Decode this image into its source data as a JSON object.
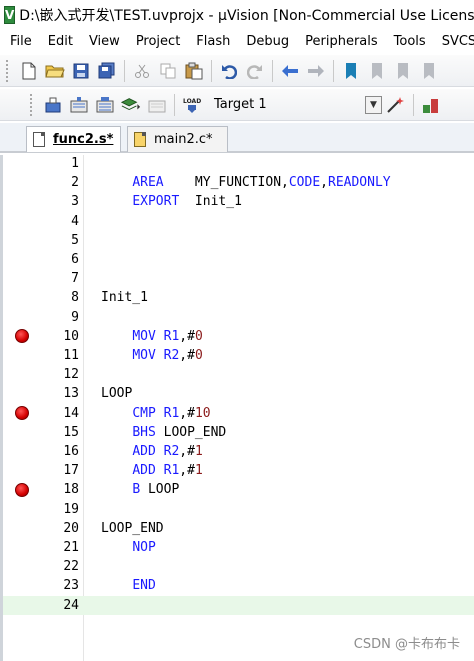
{
  "window": {
    "title": "D:\\嵌入式开发\\TEST.uvprojx - µVision  [Non-Commercial Use License]",
    "icon": "V"
  },
  "menu": [
    "File",
    "Edit",
    "View",
    "Project",
    "Flash",
    "Debug",
    "Peripherals",
    "Tools",
    "SVCS"
  ],
  "build_toolbar": {
    "target": "Target 1"
  },
  "tabs": [
    {
      "label": "func2.s*",
      "active": true
    },
    {
      "label": "main2.c*",
      "active": false
    }
  ],
  "editor": {
    "current_line": 24,
    "breakpoints": [
      10,
      14,
      18
    ],
    "lines": [
      {
        "n": "1",
        "tokens": []
      },
      {
        "n": "2",
        "tokens": [
          {
            "t": "    "
          },
          {
            "t": "AREA",
            "c": "kw"
          },
          {
            "t": "    MY_FUNCTION,"
          },
          {
            "t": "CODE",
            "c": "kw"
          },
          {
            "t": ","
          },
          {
            "t": "READONLY",
            "c": "kw"
          }
        ]
      },
      {
        "n": "3",
        "tokens": [
          {
            "t": "    "
          },
          {
            "t": "EXPORT",
            "c": "kw"
          },
          {
            "t": "  Init_1"
          }
        ]
      },
      {
        "n": "4",
        "tokens": []
      },
      {
        "n": "5",
        "tokens": []
      },
      {
        "n": "6",
        "tokens": []
      },
      {
        "n": "7",
        "tokens": []
      },
      {
        "n": "8",
        "tokens": [
          {
            "t": "Init_1"
          }
        ]
      },
      {
        "n": "9",
        "tokens": []
      },
      {
        "n": "10",
        "tokens": [
          {
            "t": "    "
          },
          {
            "t": "MOV",
            "c": "kw"
          },
          {
            "t": " "
          },
          {
            "t": "R1",
            "c": "kw"
          },
          {
            "t": ",#"
          },
          {
            "t": "0",
            "c": "num"
          }
        ]
      },
      {
        "n": "11",
        "tokens": [
          {
            "t": "    "
          },
          {
            "t": "MOV",
            "c": "kw"
          },
          {
            "t": " "
          },
          {
            "t": "R2",
            "c": "kw"
          },
          {
            "t": ",#"
          },
          {
            "t": "0",
            "c": "num"
          }
        ]
      },
      {
        "n": "12",
        "tokens": []
      },
      {
        "n": "13",
        "tokens": [
          {
            "t": "LOOP"
          }
        ]
      },
      {
        "n": "14",
        "tokens": [
          {
            "t": "    "
          },
          {
            "t": "CMP",
            "c": "kw"
          },
          {
            "t": " "
          },
          {
            "t": "R1",
            "c": "kw"
          },
          {
            "t": ",#"
          },
          {
            "t": "10",
            "c": "num"
          }
        ]
      },
      {
        "n": "15",
        "tokens": [
          {
            "t": "    "
          },
          {
            "t": "BHS",
            "c": "kw"
          },
          {
            "t": " LOOP_END"
          }
        ]
      },
      {
        "n": "16",
        "tokens": [
          {
            "t": "    "
          },
          {
            "t": "ADD",
            "c": "kw"
          },
          {
            "t": " "
          },
          {
            "t": "R2",
            "c": "kw"
          },
          {
            "t": ",#"
          },
          {
            "t": "1",
            "c": "num"
          }
        ]
      },
      {
        "n": "17",
        "tokens": [
          {
            "t": "    "
          },
          {
            "t": "ADD",
            "c": "kw"
          },
          {
            "t": " "
          },
          {
            "t": "R1",
            "c": "kw"
          },
          {
            "t": ",#"
          },
          {
            "t": "1",
            "c": "num"
          }
        ]
      },
      {
        "n": "18",
        "tokens": [
          {
            "t": "    "
          },
          {
            "t": "B",
            "c": "kw"
          },
          {
            "t": " LOOP"
          }
        ]
      },
      {
        "n": "19",
        "tokens": []
      },
      {
        "n": "20",
        "tokens": [
          {
            "t": "LOOP_END"
          }
        ]
      },
      {
        "n": "21",
        "tokens": [
          {
            "t": "    "
          },
          {
            "t": "NOP",
            "c": "kw"
          }
        ]
      },
      {
        "n": "22",
        "tokens": []
      },
      {
        "n": "23",
        "tokens": [
          {
            "t": "    "
          },
          {
            "t": "END",
            "c": "kw"
          }
        ]
      },
      {
        "n": "24",
        "tokens": []
      }
    ]
  },
  "watermark": "CSDN @卡布布卡",
  "colors": {
    "keyword": "#1a1aff",
    "number": "#8b1a1a",
    "breakpoint": "#d40000",
    "current_line": "#e8f8e8"
  }
}
